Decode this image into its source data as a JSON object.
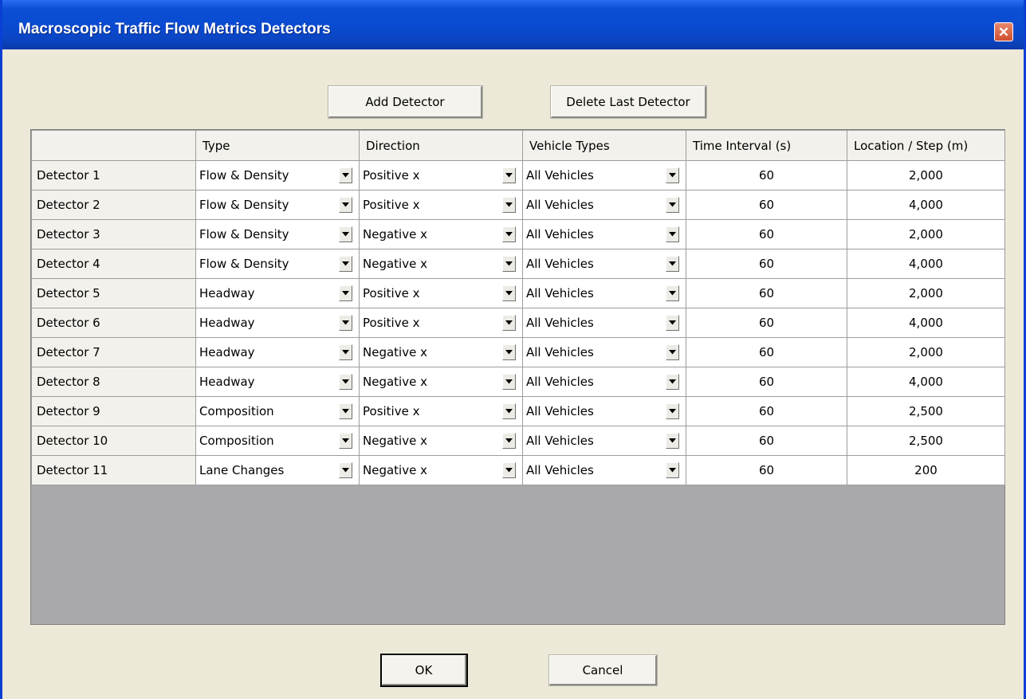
{
  "window": {
    "title": "Macroscopic Traffic Flow Metrics Detectors",
    "close_glyph": "✕"
  },
  "toolbar": {
    "add_label": "Add Detector",
    "delete_label": "Delete Last Detector"
  },
  "table": {
    "columns": [
      "",
      "Type",
      "Direction",
      "Vehicle Types",
      "Time Interval (s)",
      "Location / Step (m)"
    ],
    "rows": [
      {
        "name": "Detector 1",
        "type": "Flow & Density",
        "direction": "Positive x",
        "vehicles": "All Vehicles",
        "interval": "60",
        "location": "2,000"
      },
      {
        "name": "Detector 2",
        "type": "Flow & Density",
        "direction": "Positive x",
        "vehicles": "All Vehicles",
        "interval": "60",
        "location": "4,000"
      },
      {
        "name": "Detector 3",
        "type": "Flow & Density",
        "direction": "Negative x",
        "vehicles": "All Vehicles",
        "interval": "60",
        "location": "2,000"
      },
      {
        "name": "Detector 4",
        "type": "Flow & Density",
        "direction": "Negative x",
        "vehicles": "All Vehicles",
        "interval": "60",
        "location": "4,000"
      },
      {
        "name": "Detector 5",
        "type": "Headway",
        "direction": "Positive x",
        "vehicles": "All Vehicles",
        "interval": "60",
        "location": "2,000"
      },
      {
        "name": "Detector 6",
        "type": "Headway",
        "direction": "Positive x",
        "vehicles": "All Vehicles",
        "interval": "60",
        "location": "4,000"
      },
      {
        "name": "Detector 7",
        "type": "Headway",
        "direction": "Negative x",
        "vehicles": "All Vehicles",
        "interval": "60",
        "location": "2,000"
      },
      {
        "name": "Detector 8",
        "type": "Headway",
        "direction": "Negative x",
        "vehicles": "All Vehicles",
        "interval": "60",
        "location": "4,000"
      },
      {
        "name": "Detector 9",
        "type": "Composition",
        "direction": "Positive x",
        "vehicles": "All Vehicles",
        "interval": "60",
        "location": "2,500"
      },
      {
        "name": "Detector 10",
        "type": "Composition",
        "direction": "Negative x",
        "vehicles": "All Vehicles",
        "interval": "60",
        "location": "2,500"
      },
      {
        "name": "Detector 11",
        "type": "Lane Changes",
        "direction": "Negative x",
        "vehicles": "All Vehicles",
        "interval": "60",
        "location": "200"
      }
    ]
  },
  "footer": {
    "ok_label": "OK",
    "cancel_label": "Cancel"
  },
  "colors": {
    "titlebar": "#0b4fd6",
    "dialog_background": "#ece9d8",
    "grid_empty_area": "#a9a9ab",
    "close_button": "#d0502f"
  },
  "icons": {
    "close": "close-icon",
    "dropdown": "chevron-down-icon"
  }
}
